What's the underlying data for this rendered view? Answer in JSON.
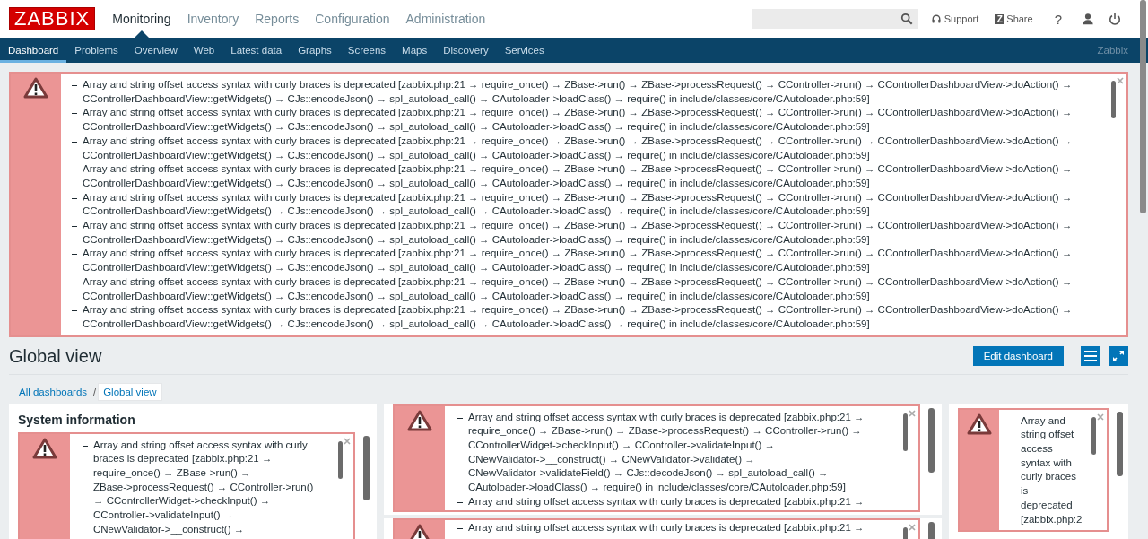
{
  "header": {
    "logo": "ZABBIX",
    "menu": [
      {
        "label": "Monitoring",
        "selected": true
      },
      {
        "label": "Inventory",
        "selected": false
      },
      {
        "label": "Reports",
        "selected": false
      },
      {
        "label": "Configuration",
        "selected": false
      },
      {
        "label": "Administration",
        "selected": false
      }
    ],
    "support": "Support",
    "share_badge": "Z",
    "share": "Share",
    "help": "?"
  },
  "subnav": {
    "items": [
      {
        "label": "Dashboard",
        "selected": true
      },
      {
        "label": "Problems",
        "selected": false
      },
      {
        "label": "Overview",
        "selected": false
      },
      {
        "label": "Web",
        "selected": false
      },
      {
        "label": "Latest data",
        "selected": false
      },
      {
        "label": "Graphs",
        "selected": false
      },
      {
        "label": "Screens",
        "selected": false
      },
      {
        "label": "Maps",
        "selected": false
      },
      {
        "label": "Discovery",
        "selected": false
      },
      {
        "label": "Services",
        "selected": false
      }
    ],
    "brand": "Zabbix"
  },
  "messages": [
    "Array and string offset access syntax with curly braces is deprecated [zabbix.php:21 → require_once() → ZBase->run() → ZBase->processRequest() → CController->run() → CControllerDashboardView->doAction() → CControllerDashboardView::getWidgets() → CJs::encodeJson() → spl_autoload_call() → CAutoloader->loadClass() → require() in include/classes/core/CAutoloader.php:59]",
    "Array and string offset access syntax with curly braces is deprecated [zabbix.php:21 → require_once() → ZBase->run() → ZBase->processRequest() → CController->run() → CControllerDashboardView->doAction() → CControllerDashboardView::getWidgets() → CJs::encodeJson() → spl_autoload_call() → CAutoloader->loadClass() → require() in include/classes/core/CAutoloader.php:59]",
    "Array and string offset access syntax with curly braces is deprecated [zabbix.php:21 → require_once() → ZBase->run() → ZBase->processRequest() → CController->run() → CControllerDashboardView->doAction() → CControllerDashboardView::getWidgets() → CJs::encodeJson() → spl_autoload_call() → CAutoloader->loadClass() → require() in include/classes/core/CAutoloader.php:59]",
    "Array and string offset access syntax with curly braces is deprecated [zabbix.php:21 → require_once() → ZBase->run() → ZBase->processRequest() → CController->run() → CControllerDashboardView->doAction() → CControllerDashboardView::getWidgets() → CJs::encodeJson() → spl_autoload_call() → CAutoloader->loadClass() → require() in include/classes/core/CAutoloader.php:59]",
    "Array and string offset access syntax with curly braces is deprecated [zabbix.php:21 → require_once() → ZBase->run() → ZBase->processRequest() → CController->run() → CControllerDashboardView->doAction() → CControllerDashboardView::getWidgets() → CJs::encodeJson() → spl_autoload_call() → CAutoloader->loadClass() → require() in include/classes/core/CAutoloader.php:59]",
    "Array and string offset access syntax with curly braces is deprecated [zabbix.php:21 → require_once() → ZBase->run() → ZBase->processRequest() → CController->run() → CControllerDashboardView->doAction() → CControllerDashboardView::getWidgets() → CJs::encodeJson() → spl_autoload_call() → CAutoloader->loadClass() → require() in include/classes/core/CAutoloader.php:59]",
    "Array and string offset access syntax with curly braces is deprecated [zabbix.php:21 → require_once() → ZBase->run() → ZBase->processRequest() → CController->run() → CControllerDashboardView->doAction() → CControllerDashboardView::getWidgets() → CJs::encodeJson() → spl_autoload_call() → CAutoloader->loadClass() → require() in include/classes/core/CAutoloader.php:59]",
    "Array and string offset access syntax with curly braces is deprecated [zabbix.php:21 → require_once() → ZBase->run() → ZBase->processRequest() → CController->run() → CControllerDashboardView->doAction() → CControllerDashboardView::getWidgets() → CJs::encodeJson() → spl_autoload_call() → CAutoloader->loadClass() → require() in include/classes/core/CAutoloader.php:59]",
    "Array and string offset access syntax with curly braces is deprecated [zabbix.php:21 → require_once() → ZBase->run() → ZBase->processRequest() → CController->run() → CControllerDashboardView->doAction() → CControllerDashboardView::getWidgets() → CJs::encodeJson() → spl_autoload_call() → CAutoloader->loadClass() → require() in include/classes/core/CAutoloader.php:59]"
  ],
  "page": {
    "title": "Global view",
    "edit_button": "Edit dashboard"
  },
  "breadcrumbs": {
    "separator": "/",
    "items": [
      {
        "label": "All dashboards",
        "selected": false
      },
      {
        "label": "Global view",
        "selected": true
      }
    ]
  },
  "widgets": [
    {
      "title": "System information",
      "messages": [
        "Array and string offset access syntax with curly braces is deprecated [zabbix.php:21 → require_once() → ZBase->run() → ZBase->processRequest() → CController->run() → CControllerWidget->checkInput() → CController->validateInput() → CNewValidator->__construct() →"
      ]
    },
    {
      "messages": [
        "Array and string offset access syntax with curly braces is deprecated [zabbix.php:21 → require_once() → ZBase->run() → ZBase->processRequest() → CController->run() → CControllerWidget->checkInput() → CController->validateInput() → CNewValidator->__construct() → CNewValidator->validate() → CNewValidator->validateField() → CJs::decodeJson() → spl_autoload_call() → CAutoloader->loadClass() → require() in include/classes/core/CAutoloader.php:59]",
        "Array and string offset access syntax with curly braces is deprecated [zabbix.php:21 →"
      ]
    },
    {
      "messages": [
        "Array and string offset access syntax with curly braces is deprecated [zabbix.php:21 →"
      ]
    },
    {
      "messages": [
        "Array and string offset access syntax with curly braces is deprecated [zabbix.php:2"
      ]
    }
  ]
}
